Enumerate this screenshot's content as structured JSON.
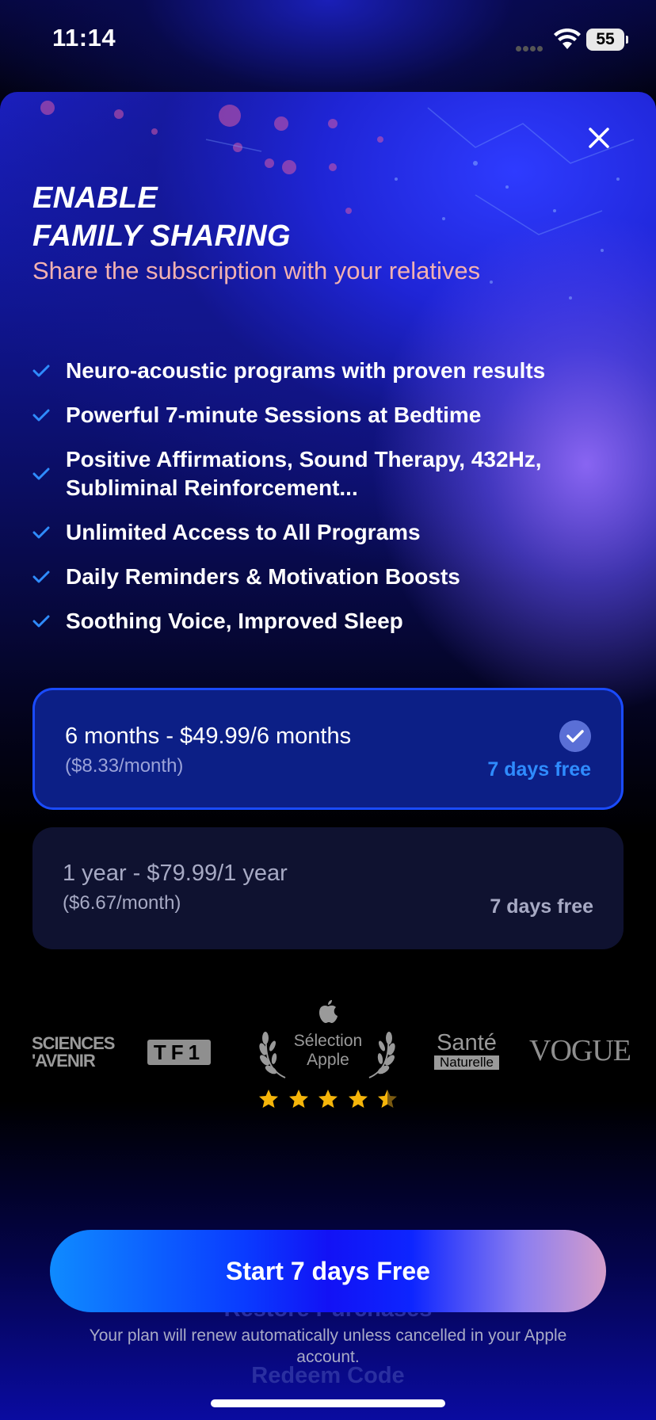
{
  "status_bar": {
    "time": "11:14",
    "battery": "55"
  },
  "paywall": {
    "headline_line1": "ENABLE",
    "headline_line2": "FAMILY SHARING",
    "subtitle": "Share the subscription with your relatives",
    "features": [
      "Neuro-acoustic programs with proven results",
      "Powerful 7-minute Sessions at Bedtime",
      "Positive Affirmations, Sound Therapy, 432Hz, Subliminal Reinforcement...",
      "Unlimited Access to All Programs",
      "Daily Reminders & Motivation Boosts",
      "Soothing Voice, Improved Sleep"
    ],
    "plans": [
      {
        "title": "6 months - $49.99/6 months",
        "per_month": "($8.33/month)",
        "trial": "7 days free",
        "selected": true
      },
      {
        "title": "1 year - $79.99/1 year",
        "per_month": "($6.67/month)",
        "trial": "7 days free",
        "selected": false
      }
    ],
    "press_logos": {
      "sciences_line1": "SCIENCES",
      "sciences_line2": "'AVENIR",
      "tf1": "TF1",
      "selection_line1": "Sélection",
      "selection_line2": "Apple",
      "sante_line1": "Santé",
      "sante_line2": "Naturelle",
      "vogue": "VOGUE",
      "rating_stars": 4.5
    },
    "cta_label": "Start 7 days Free",
    "restore_label": "Restore Purchases",
    "legal_text": "Your plan will renew automatically unless cancelled in your Apple account.",
    "redeem_label": "Redeem Code"
  },
  "colors": {
    "accent_blue": "#2f8cff",
    "selected_border": "#1a4bff",
    "subtitle_pink": "#f2b1b1",
    "star_gold": "#f5b50a"
  }
}
